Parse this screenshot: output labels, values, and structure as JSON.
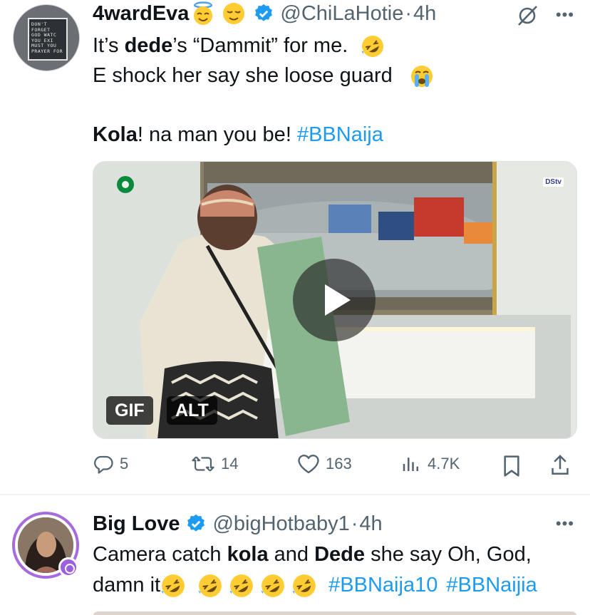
{
  "tweets": [
    {
      "display_name": "4wardEva",
      "handle": "@ChiLaHotie",
      "separator": "·",
      "time": "4h",
      "avatar_sign_lines": [
        "DON'T",
        "FORGET",
        "GOD WATC",
        "YOU EXI",
        "MUST YOU",
        "PRAYER FOR"
      ],
      "text": {
        "line1_pre": "It’s ",
        "line1_bold": "dede",
        "line1_post": "’s “Dammit” for me.",
        "line2": "E shock her say she loose guard",
        "line3_bold": "Kola",
        "line3_mid": "! na man you be! ",
        "line3_hashtag": "#BBNaija"
      },
      "media": {
        "badges": [
          "GIF",
          "ALT"
        ],
        "channel_logo": "DStv"
      },
      "actions": {
        "reply_count": "5",
        "retweet_count": "14",
        "like_count": "163",
        "view_count": "4.7K"
      },
      "icons": [
        "grok-icon",
        "more-icon",
        "verified-badge-icon",
        "reply-icon",
        "retweet-icon",
        "like-icon",
        "views-icon",
        "bookmark-icon",
        "share-icon"
      ]
    },
    {
      "display_name": "Big Love",
      "handle": "@bigHotbaby1",
      "separator": "·",
      "time": "4h",
      "text": {
        "line1_pre": "Camera catch ",
        "line1_bold1": "kola",
        "line1_mid": " and ",
        "line1_bold2": "Dede",
        "line1_post": " she say Oh, God,",
        "line2_pre": "damn it",
        "hashtag1": "#BBNaija10",
        "hashtag2": "#BBNaijia"
      }
    }
  ],
  "colors": {
    "accent": "#1d9bf0",
    "muted": "#536471",
    "text": "#0f1419",
    "avatar_ring": "#a66bdc"
  }
}
